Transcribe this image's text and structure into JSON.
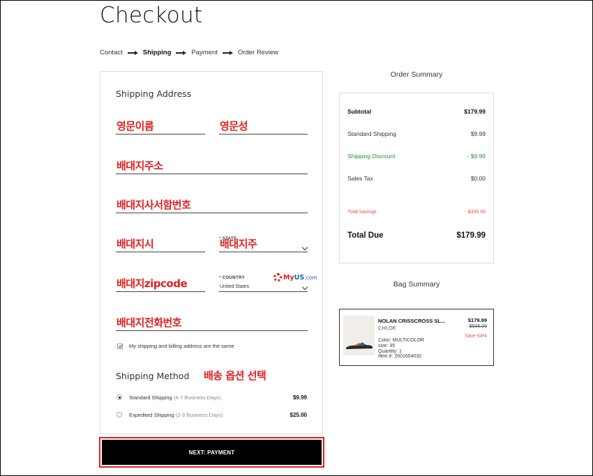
{
  "page_title": "Checkout",
  "breadcrumb": [
    "Contact",
    "Shipping",
    "Payment",
    "Order Review"
  ],
  "shipping_address": {
    "title": "Shipping Address",
    "first_name": "영문이름",
    "last_name": "영문성",
    "address": "배대지주소",
    "apt": "배대지사서함번호",
    "city": "배대지시",
    "state_label": "STATE",
    "state_value": "배대지주",
    "zip": "배대지zipcode",
    "country_label": "COUNTRY",
    "country_value": "United States",
    "phone": "배대지전화번호",
    "logo_my": "My",
    "logo_us": "US",
    "logo_com": ".com",
    "same_billing": "My shipping and billing address are the same"
  },
  "shipping_method": {
    "title": "Shipping Method",
    "annotation": "배송 옵션 선택",
    "options": [
      {
        "name": "Standard Shipping",
        "days": "(4-7 Business Days)",
        "price": "$9.99",
        "selected": true
      },
      {
        "name": "Expedited Shipping",
        "days": "(2-3 Business Days)",
        "price": "$25.00",
        "selected": false
      }
    ]
  },
  "next_button": "NEXT: PAYMENT",
  "order_summary": {
    "title": "Order Summary",
    "subtotal_label": "Subtotal",
    "subtotal": "$179.99",
    "shipping_label": "Standard Shipping",
    "shipping": "$9.99",
    "discount_label": "Shipping Discount",
    "discount": "- $9.99",
    "tax_label": "Sales Tax",
    "tax": "$0.00",
    "savings_label": "Total Savings",
    "savings": "- $335.00",
    "total_label": "Total Due",
    "total": "$179.99"
  },
  "bag_summary": {
    "title": "Bag Summary",
    "item": {
      "name": "NOLAN CRISSCROSS SL...",
      "brand": "CHLOE",
      "color": "Color: MULTICOLOR",
      "size": "size: 35",
      "quantity": "Quantity: 1",
      "item_no": "Item #: 2001654032",
      "price": "$179.99",
      "original_price": "$505.00",
      "save": "Save 64%"
    }
  },
  "colors": {
    "annotation_red": "#e02020",
    "discount_green": "#2e8b3d",
    "savings_red": "#d9534f"
  }
}
